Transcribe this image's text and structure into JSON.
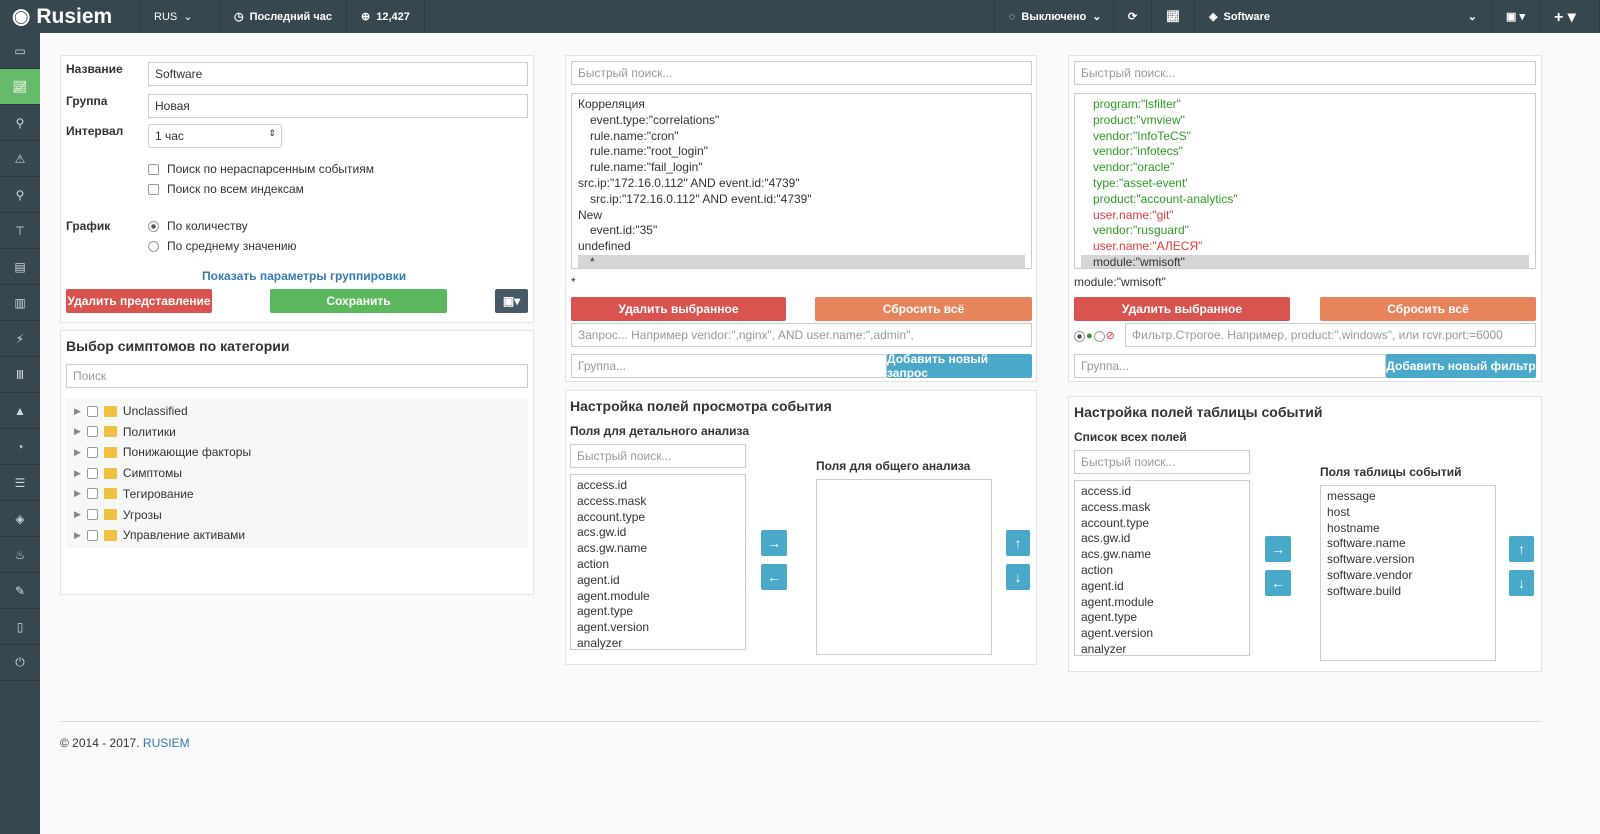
{
  "topbar": {
    "logo": "Rusiem",
    "lang": "RUS",
    "time_range": "Последний час",
    "count": "12,427",
    "refresh": "Выключено",
    "view": "Software"
  },
  "sidebar": [
    "monitor-icon",
    "chart-icon",
    "antenna-icon",
    "warning-icon",
    "search-icon",
    "sitemap-icon",
    "list-icon",
    "book-icon",
    "bolt-icon",
    "library-icon",
    "bell-icon",
    "pie-icon",
    "list-ul-icon",
    "layers-icon",
    "fire-icon",
    "wrench-icon",
    "file-icon",
    "power-icon"
  ],
  "form": {
    "name_label": "Название",
    "name_value": "Software",
    "group_label": "Группа",
    "group_value": "Новая",
    "interval_label": "Интервал",
    "interval_value": "1 час",
    "cb1": "Поиск по нераспарсенным событиям",
    "cb2": "Поиск по всем индексам",
    "chart_label": "График",
    "radio1": "По количеству",
    "radio2": "По среднему значению",
    "show_grouping": "Показать параметры группировки",
    "delete": "Удалить представление",
    "save": "Сохранить"
  },
  "symptoms": {
    "title": "Выбор симптомов по категории",
    "search_ph": "Поиск",
    "items": [
      "Unclassified",
      "Политики",
      "Понижающие факторы",
      "Симптомы",
      "Тегирование",
      "Угрозы",
      "Управление активами"
    ]
  },
  "queries": {
    "search_ph": "Быстрый поиск...",
    "lines": [
      {
        "t": "Корреляция",
        "i": 0
      },
      {
        "t": "event.type:\"correlations\"",
        "i": 1
      },
      {
        "t": "rule.name:\"cron\"",
        "i": 1
      },
      {
        "t": "rule.name:\"root_login\"",
        "i": 1
      },
      {
        "t": "rule.name:\"fail_login\"",
        "i": 1
      },
      {
        "t": "src.ip:\"172.16.0.112\" AND event.id:\"4739\"",
        "i": 0
      },
      {
        "t": "src.ip:\"172.16.0.112\" AND event.id:\"4739\"",
        "i": 1
      },
      {
        "t": "New",
        "i": 0
      },
      {
        "t": "event.id:\"35\"",
        "i": 1
      },
      {
        "t": "undefined",
        "i": 0
      },
      {
        "t": "*",
        "i": 1
      }
    ],
    "current": "*",
    "delete": "Удалить выбранное",
    "reset": "Сбросить всё",
    "query_ph": "Запрос... Например vendor:\",nginx\", AND user.name:\",admin\",",
    "group_ph": "Группа...",
    "add": "Добавить новый запрос"
  },
  "filters": {
    "search_ph": "Быстрый поиск...",
    "lines": [
      {
        "t": "program:\"lsfilter\"",
        "c": "g"
      },
      {
        "t": "product:\"vmview\"",
        "c": "g"
      },
      {
        "t": "vendor:\"InfoTeCS\"",
        "c": "g"
      },
      {
        "t": "vendor:\"infotecs\"",
        "c": "g"
      },
      {
        "t": "vendor:\"oracle\"",
        "c": "g"
      },
      {
        "t": "type:\"asset-event'",
        "c": "g"
      },
      {
        "t": "product:\"account-analytics\"",
        "c": "g"
      },
      {
        "t": "user.name:\"git\"",
        "c": "r"
      },
      {
        "t": "vendor:\"rusguard\"",
        "c": "g"
      },
      {
        "t": "user.name:\"АЛЕСЯ\"",
        "c": "r"
      },
      {
        "t": "module:\"wmisoft\"",
        "c": "s"
      }
    ],
    "current": "module:\"wmisoft\"",
    "delete": "Удалить выбранное",
    "reset": "Сбросить всё",
    "filter_ph": "Фильтр.Строгое. Например, product:\",windows\", или rcvr.port:=6000",
    "group_ph": "Группа...",
    "add": "Добавить новый фильтр"
  },
  "fields_view": {
    "title": "Настройка полей просмотра события",
    "detail_label": "Поля для детального анализа",
    "search_ph": "Быстрый поиск...",
    "general_label": "Поля для общего анализа",
    "items": [
      "access.id",
      "access.mask",
      "account.type",
      "acs.gw.id",
      "acs.gw.name",
      "action",
      "agent.id",
      "agent.module",
      "agent.type",
      "agent.version",
      "analyzer"
    ]
  },
  "fields_table": {
    "title": "Настройка полей таблицы событий",
    "all_label": "Список всех полей",
    "search_ph": "Быстрый поиск...",
    "table_label": "Поля таблицы событий",
    "items": [
      "access.id",
      "access.mask",
      "account.type",
      "acs.gw.id",
      "acs.gw.name",
      "action",
      "agent.id",
      "agent.module",
      "agent.type",
      "agent.version",
      "analyzer"
    ],
    "table_items": [
      "message",
      "host",
      "hostname",
      "software.name",
      "software.version",
      "software.vendor",
      "software.build"
    ]
  },
  "footer": {
    "copy": "© 2014 - 2017.",
    "link": "RUSIEM"
  }
}
